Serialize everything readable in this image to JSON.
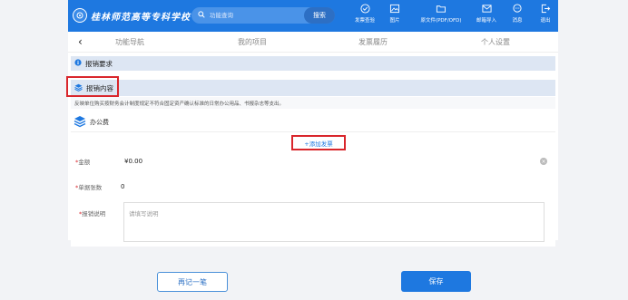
{
  "header": {
    "school_name": "桂林师范高等专科学校",
    "search_placeholder": "功能查询",
    "search_button": "搜索",
    "nav": [
      {
        "label": "发票查验",
        "icon": "inspect-icon"
      },
      {
        "label": "图片",
        "icon": "image-icon"
      },
      {
        "label": "原文件(PDF/OFD)",
        "icon": "folder-icon"
      },
      {
        "label": "邮箱导入",
        "icon": "mail-icon"
      },
      {
        "label": "消息",
        "icon": "message-icon"
      },
      {
        "label": "退出",
        "icon": "logout-icon"
      }
    ]
  },
  "tabs": [
    "功能导航",
    "我的项目",
    "发票履历",
    "个人设置"
  ],
  "sections": {
    "requirements": "报销要求",
    "content": "报销内容"
  },
  "notice": "反映单位购买按财务会计制度规定不符合固定资产确认标准的日常办公用品、书报杂志等支出。",
  "category": "办公费",
  "add_invoice": "+添加发票",
  "form": {
    "amount_label": "金额",
    "amount_value": "¥0.00",
    "count_label": "单据张数",
    "count_value": "0",
    "desc_label": "报销说明",
    "desc_placeholder": "请填写说明"
  },
  "buttons": {
    "again": "再记一笔",
    "save": "保存"
  },
  "colors": {
    "brand": "#1e78e0",
    "highlight": "#d9262c"
  }
}
